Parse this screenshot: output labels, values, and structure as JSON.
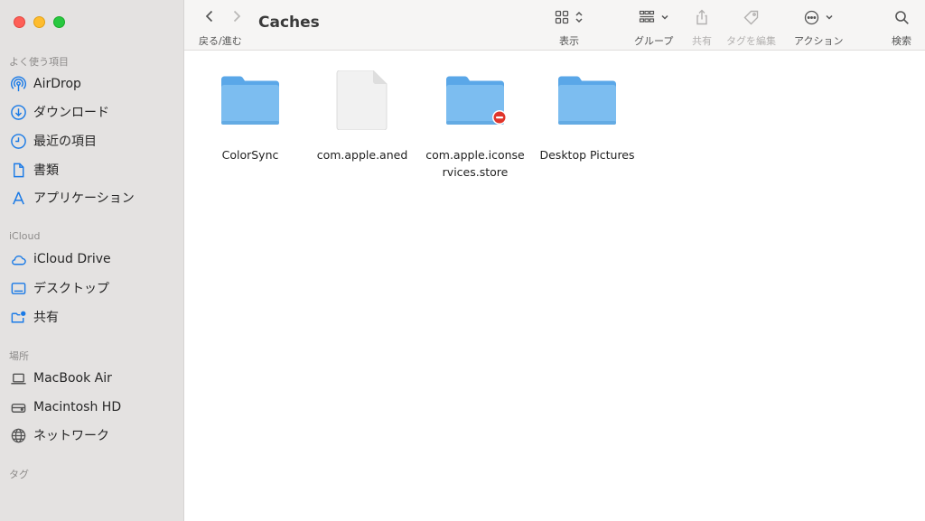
{
  "window": {
    "title": "Caches"
  },
  "sidebar": {
    "favorites_label": "よく使う項目",
    "favorites": [
      {
        "label": "AirDrop",
        "icon": "airdrop-icon"
      },
      {
        "label": "ダウンロード",
        "icon": "download-icon"
      },
      {
        "label": "最近の項目",
        "icon": "clock-icon"
      },
      {
        "label": "書類",
        "icon": "document-icon"
      },
      {
        "label": "アプリケーション",
        "icon": "applications-icon"
      }
    ],
    "icloud_label": "iCloud",
    "icloud": [
      {
        "label": "iCloud Drive",
        "icon": "cloud-icon"
      },
      {
        "label": "デスクトップ",
        "icon": "desktop-icon"
      },
      {
        "label": "共有",
        "icon": "shared-folder-icon"
      }
    ],
    "locations_label": "場所",
    "locations": [
      {
        "label": "MacBook Air",
        "icon": "laptop-icon"
      },
      {
        "label": "Macintosh HD",
        "icon": "disk-icon"
      },
      {
        "label": "ネットワーク",
        "icon": "globe-icon"
      }
    ],
    "tags_label": "タグ"
  },
  "toolbar": {
    "nav_label": "戻る/進む",
    "view_label": "表示",
    "group_label": "グループ",
    "share_label": "共有",
    "tags_label": "タグを編集",
    "action_label": "アクション",
    "search_label": "検索"
  },
  "files": [
    {
      "name_line1": "ColorSync",
      "name_line2": "",
      "kind": "folder"
    },
    {
      "name_line1": "com.apple.aned",
      "name_line2": "",
      "kind": "document"
    },
    {
      "name_line1": "com.apple.iconse",
      "name_line2": "rvices.store",
      "kind": "folder-restricted"
    },
    {
      "name_line1": "Desktop Pictures",
      "name_line2": "",
      "kind": "folder"
    }
  ],
  "colors": {
    "sidebar_icon": "#1a7ae6",
    "folder_body": "#7cbdf0",
    "folder_tab": "#5aa7e8",
    "restricted_badge": "#e0352b"
  }
}
